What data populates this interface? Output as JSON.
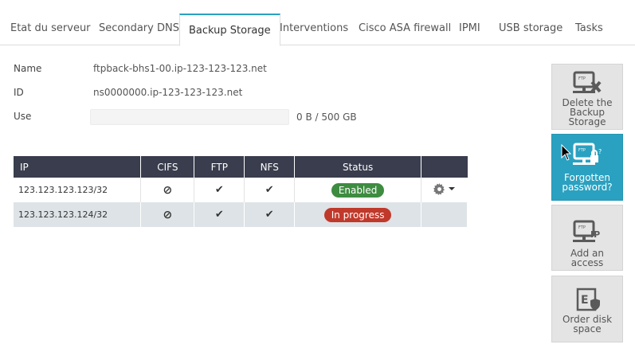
{
  "tabs": [
    {
      "label": "Etat du serveur"
    },
    {
      "label": "Secondary DNS"
    },
    {
      "label": "Backup Storage",
      "active": true
    },
    {
      "label": "Interventions"
    },
    {
      "label": "Cisco ASA firewall"
    },
    {
      "label": "IPMI"
    },
    {
      "label": "USB storage"
    },
    {
      "label": "Tasks"
    }
  ],
  "info": {
    "name_label": "Name",
    "name_value": "ftpback-bhs1-00.ip-123-123-123.net",
    "id_label": "ID",
    "id_value": "ns0000000.ip-123-123-123.net",
    "use_label": "Use",
    "use_value": "0 B / 500 GB",
    "use_fraction": 0
  },
  "table": {
    "headers": [
      "IP",
      "CIFS",
      "FTP",
      "NFS",
      "Status"
    ],
    "rows": [
      {
        "ip": "123.123.123.123/32",
        "cifs": "⊘",
        "ftp": "✔",
        "nfs": "✔",
        "status": "Enabled",
        "status_color": "#3d8c40",
        "has_actions": true
      },
      {
        "ip": "123.123.123.124/32",
        "cifs": "⊘",
        "ftp": "✔",
        "nfs": "✔",
        "status": "In progress",
        "status_color": "#c0392b",
        "has_actions": false
      }
    ]
  },
  "side": {
    "delete_label": "Delete the Backup Storage",
    "forgotten_label": "Forgotten password?",
    "add_access_label": "Add an access",
    "order_disk_label": "Order disk space"
  },
  "colors": {
    "accent": "#2aa1c0",
    "table_header": "#393d4d",
    "enabled": "#3d8c40",
    "in_progress": "#c0392b"
  },
  "icons": {
    "delete": "ftp-server-delete-icon",
    "forgotten": "ftp-server-lock-icon",
    "add_access": "ftp-ip-icon",
    "order_disk": "exchange-shield-icon",
    "actions": "gear-icon"
  }
}
